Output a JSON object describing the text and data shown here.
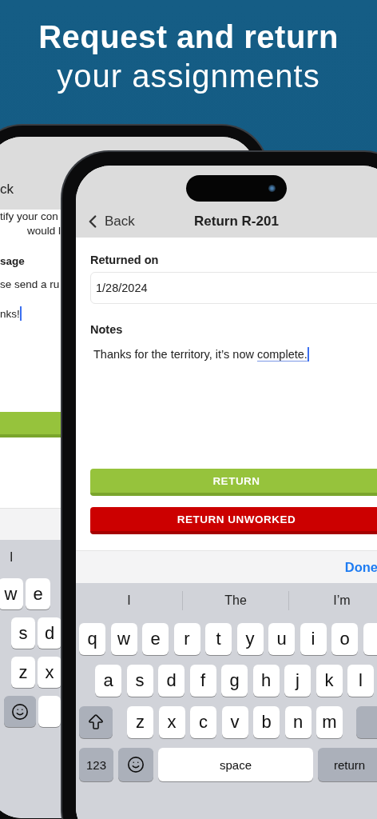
{
  "headline": {
    "title": "Request and return",
    "subtitle": "your assignments"
  },
  "back_phone": {
    "nav_back": "ck",
    "intro_lines": [
      "tify your con",
      "would l"
    ],
    "message_label": "sage",
    "message_lines": [
      "se send a ru",
      "nks!"
    ],
    "suggestion": "I",
    "key_rows": [
      [
        "w",
        "e"
      ],
      [
        "s",
        "d"
      ],
      [
        "z",
        "x"
      ]
    ]
  },
  "front_phone": {
    "back": "Back",
    "title": "Return R-201",
    "returned_on": {
      "label": "Returned on",
      "value": "1/28/2024"
    },
    "notes": {
      "label": "Notes",
      "text": "Thanks for the territory, it’s now ",
      "flagged_word": "complete."
    },
    "buttons": [
      {
        "label": "RETURN",
        "kind": "primary"
      },
      {
        "label": "RETURN UNWORKED",
        "kind": "danger"
      }
    ],
    "done": "Done",
    "suggestions": [
      "I",
      "The",
      "I’m"
    ],
    "key_rows": [
      [
        "q",
        "w",
        "e",
        "r",
        "t",
        "y",
        "u",
        "i",
        "o"
      ],
      [
        "a",
        "s",
        "d",
        "f",
        "g",
        "h",
        "j",
        "k",
        "l"
      ],
      [
        "z",
        "x",
        "c",
        "v",
        "b",
        "n",
        "m"
      ]
    ],
    "numbers_key": "123",
    "space_key": "space",
    "return_key": "return"
  }
}
